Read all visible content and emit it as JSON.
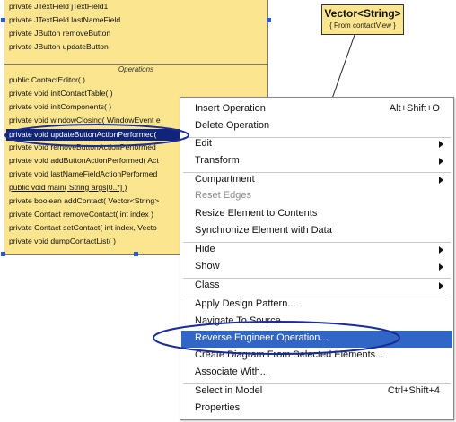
{
  "class_box": {
    "attributes": [
      "private  JTextField  jTextField1",
      "private  JTextField  lastNameField",
      "private  JButton  removeButton",
      "private  JButton  updateButton"
    ],
    "operations_header": "Operations",
    "operations": [
      "public  ContactEditor(  )",
      "private  void  initContactTable(  )",
      "private  void  initComponents(  )",
      "private  void  windowClosing( WindowEvent e",
      "private  void  updateButtonActionPerformed(",
      "private  void  removeButtonActionPerformed",
      "private  void  addButtonActionPerformed(  Act",
      "private  void  lastNameFieldActionPerformed",
      "public  void  main( String args[0..*] )",
      "private  boolean  addContact(  Vector<String>",
      "private  Contact  removeContact( int index )",
      "private  Contact  setContact( int index,  Vecto",
      "private  void  dumpContactList(  )"
    ],
    "selected_index": 4
  },
  "vector_box": {
    "title": "Vector<String>",
    "subtitle": "{ From contactView }"
  },
  "context_menu": {
    "items": [
      {
        "label": "Insert Operation",
        "shortcut": "Alt+Shift+O"
      },
      {
        "label": "Delete Operation",
        "shortcut": ""
      },
      {
        "label": "Edit",
        "shortcut": ""
      },
      {
        "label": "Transform",
        "shortcut": ""
      },
      {
        "label": "Compartment",
        "shortcut": ""
      },
      {
        "label": "Reset Edges",
        "shortcut": ""
      },
      {
        "label": "Resize Element to Contents",
        "shortcut": ""
      },
      {
        "label": "Synchronize Element with Data",
        "shortcut": ""
      },
      {
        "label": "Hide",
        "shortcut": ""
      },
      {
        "label": "Show",
        "shortcut": ""
      },
      {
        "label": "Class",
        "shortcut": ""
      },
      {
        "label": "Apply Design Pattern...",
        "shortcut": ""
      },
      {
        "label": "Navigate To Source",
        "shortcut": ""
      },
      {
        "label": "Reverse Engineer Operation...",
        "shortcut": ""
      },
      {
        "label": "Create Diagram From Selected Elements...",
        "shortcut": ""
      },
      {
        "label": "Associate With...",
        "shortcut": ""
      },
      {
        "label": "Select in Model",
        "shortcut": "Ctrl+Shift+4"
      },
      {
        "label": "Properties",
        "shortcut": ""
      }
    ]
  },
  "colors": {
    "class_fill": "#fbe58f",
    "selection": "#10247a",
    "menu_highlight": "#3166c6",
    "ellipse": "#1a2c9a",
    "handles": "#2a5ad7"
  }
}
